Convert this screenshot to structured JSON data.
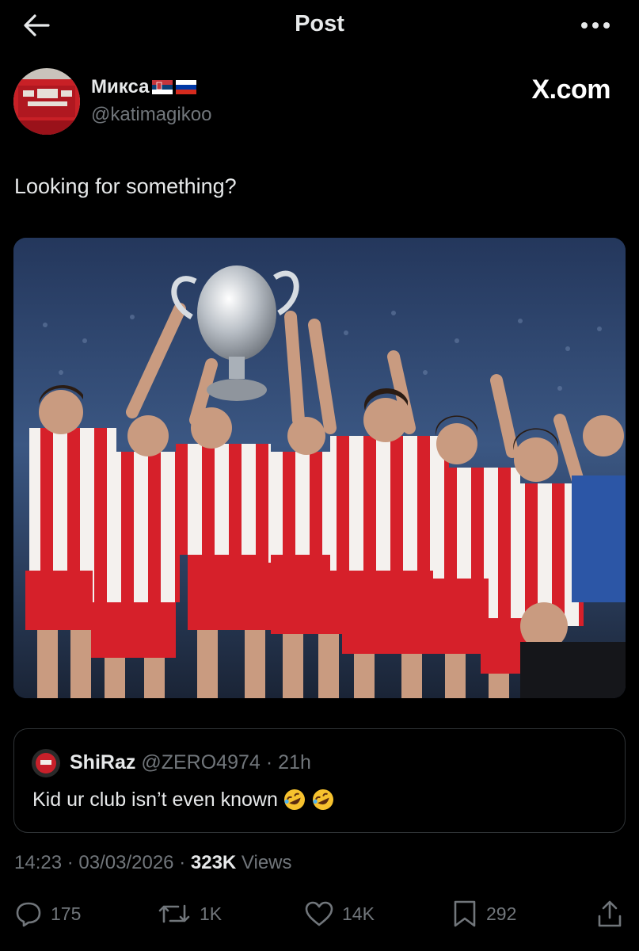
{
  "header": {
    "title": "Post",
    "back_icon": "arrow-left-icon",
    "more_icon": "more-horizontal-icon"
  },
  "author": {
    "display_name": "Микса",
    "flags": [
      "serbia-flag-icon",
      "russia-flag-icon"
    ],
    "handle": "@katimagikoo"
  },
  "watermark": "X.com",
  "post": {
    "text": "Looking for something?"
  },
  "quote": {
    "name": "ShiRaz",
    "handle": "@ZERO4974",
    "separator": "·",
    "time": "21h",
    "text": "Kid ur club isn’t even known",
    "emojis": [
      "rofl-emoji-icon",
      "rofl-emoji-icon"
    ]
  },
  "meta": {
    "time": "14:23",
    "sep1": "·",
    "date": "03/03/2026",
    "sep2": "·",
    "views_count": "323K",
    "views_label": "Views"
  },
  "actions": {
    "reply": {
      "icon": "reply-icon",
      "count": "175"
    },
    "repost": {
      "icon": "repost-icon",
      "count": "1K"
    },
    "like": {
      "icon": "heart-icon",
      "count": "14K"
    },
    "bookmark": {
      "icon": "bookmark-icon",
      "count": "292"
    },
    "share": {
      "icon": "share-icon"
    }
  },
  "colors": {
    "background": "#000000",
    "text": "#e7e9ea",
    "muted": "#71767b",
    "border": "#2f3336",
    "jersey_red": "#d6202a"
  }
}
